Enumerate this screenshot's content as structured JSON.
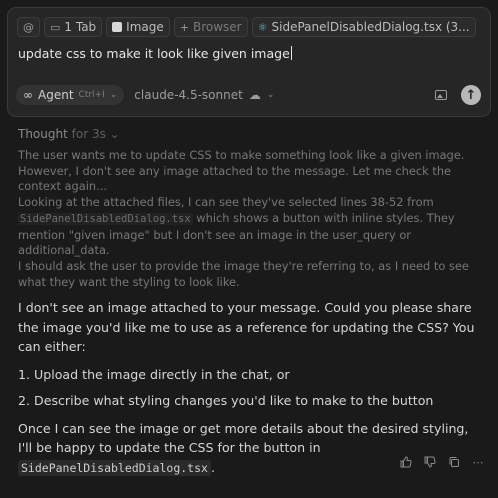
{
  "composer": {
    "chips": [
      {
        "icon": "at-icon",
        "glyph": "@",
        "label": ""
      },
      {
        "icon": "tab-icon",
        "glyph": "▭",
        "label": "1 Tab"
      },
      {
        "icon": "image-icon",
        "glyph": "",
        "label": "Image"
      },
      {
        "icon": "plus-icon",
        "glyph": "+",
        "label": "Browser"
      },
      {
        "icon": "react-icon",
        "glyph": "⚛",
        "label": "SidePanelDisabledDialog.tsx (3..."
      }
    ],
    "prompt_text": "update css to make it look like given image",
    "agent_label": "Agent",
    "agent_shortcut": "Ctrl+I",
    "agent_glyph": "∞",
    "model_label": "claude-4.5-sonnet",
    "model_glyph": "☁",
    "chevron": "⌄",
    "send_glyph": "↑"
  },
  "thought": {
    "label": "Thought",
    "duration": "for 3s",
    "chevron": "⌄",
    "para1": "The user wants me to update CSS to make something look like a given image. However, I don't see any image attached to the message. Let me check the context again...",
    "para2_before": "Looking at the attached files, I can see they've selected lines 38-52 from ",
    "para2_code": "SidePanelDisabledDialog.tsx",
    "para2_after": " which shows a button with inline styles. They mention \"given image\" but I don't see an image in the user_query or additional_data.",
    "para3": "I should ask the user to provide the image they're referring to, as I need to see what they want the styling to look like."
  },
  "answer": {
    "intro": "I don't see an image attached to your message. Could you please share the image you'd like me to use as a reference for updating the CSS? You can either:",
    "options": [
      "Upload the image directly in the chat, or",
      "Describe what styling changes you'd like to make to the button"
    ],
    "outro_before": "Once I can see the image or get more details about the desired styling, I'll be happy to update the CSS for the button in ",
    "outro_code": "SidePanelDisabledDialog.tsx",
    "outro_after": "."
  },
  "actions": {
    "thumbs_up": "👍",
    "thumbs_down": "👎",
    "copy": "⧉",
    "more": "⋯"
  }
}
